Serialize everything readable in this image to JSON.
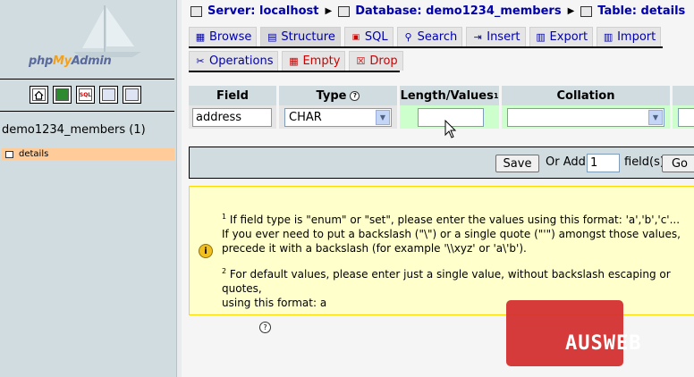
{
  "logo": {
    "text": "phpMyAdmin",
    "p1": "php",
    "p2": "My",
    "p3": "Admin"
  },
  "left": {
    "db_link": "demo1234_members (1)",
    "tables": [
      {
        "name": "details"
      }
    ],
    "icons": [
      "home-icon",
      "sql-window-icon",
      "sql-query-icon",
      "docs-icon",
      "help-icon"
    ]
  },
  "breadcrumb": {
    "server": "Server: localhost",
    "database": "Database: demo1234_members",
    "table": "Table: details",
    "separator": "▶"
  },
  "tabs_row1": [
    {
      "label": "Browse",
      "icon": "browse-icon"
    },
    {
      "label": "Structure",
      "icon": "structure-icon",
      "active": true
    },
    {
      "label": "SQL",
      "icon": "sql-icon"
    },
    {
      "label": "Search",
      "icon": "search-icon"
    },
    {
      "label": "Insert",
      "icon": "insert-icon"
    },
    {
      "label": "Export",
      "icon": "export-icon"
    },
    {
      "label": "Import",
      "icon": "import-icon"
    }
  ],
  "tabs_row2": [
    {
      "label": "Operations",
      "icon": "operations-icon"
    },
    {
      "label": "Empty",
      "icon": "empty-icon",
      "danger": true
    },
    {
      "label": "Drop",
      "icon": "drop-icon",
      "danger": true
    }
  ],
  "grid": {
    "headers": {
      "field": "Field",
      "type": "Type",
      "length": "Length/Values",
      "length_sup": "1",
      "collation": "Collation"
    },
    "row": {
      "field_value": "address",
      "type_value": "CHAR",
      "length_value": "",
      "collation_value": ""
    }
  },
  "savebar": {
    "save_label": "Save",
    "or_add": "Or Add",
    "count": "1",
    "fields_label": "field(s)",
    "go_label": "Go"
  },
  "notes": {
    "n1_sup": "1",
    "n1_line1": "If field type is \"enum\" or \"set\", please enter the values using this format: 'a','b','c'...",
    "n1_line2": "If you ever need to put a backslash (\"\\\") or a single quote (\"'\") amongst those values,",
    "n1_line3": "precede it with a backslash (for example '\\\\xyz' or 'a\\'b').",
    "n2_sup": "2",
    "n2_line1": "For default values, please enter just a single value, without backslash escaping or quotes,",
    "n2_line2": "using this format: a"
  },
  "watermark": {
    "text": "AUSWEB"
  },
  "colors": {
    "link": "#0000aa",
    "danger": "#cc0000",
    "nav_bg": "#d0dce0",
    "note_bg": "#ffffcc",
    "selected_table": "#ffcc99"
  }
}
